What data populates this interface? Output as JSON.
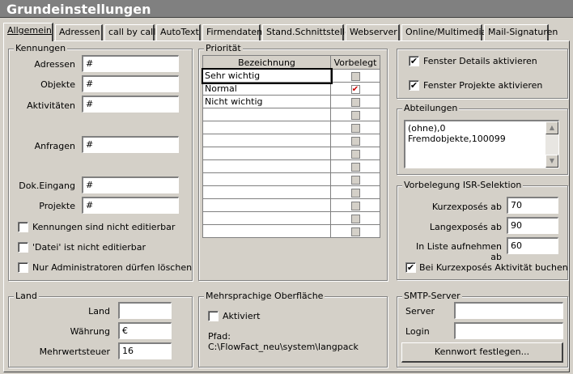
{
  "title": "Grundeinstellungen",
  "tabs": [
    "Allgemein",
    "Adressen",
    "call by call",
    "AutoText",
    "Firmendaten",
    "Stand.Schnittstellen",
    "Webserver",
    "Online/Multimedia",
    "Mail-Signaturen"
  ],
  "kennungen": {
    "legend": "Kennungen",
    "adressen_label": "Adressen",
    "adressen_value": "#",
    "objekte_label": "Objekte",
    "objekte_value": "#",
    "aktivitaeten_label": "Aktivitäten",
    "aktivitaeten_value": "#",
    "anfragen_label": "Anfragen",
    "anfragen_value": "#",
    "dokeingang_label": "Dok.Eingang",
    "dokeingang_value": "#",
    "projekte_label": "Projekte",
    "projekte_value": "#",
    "cb1": "Kennungen sind nicht editierbar",
    "cb2": "'Datei' ist nicht editierbar",
    "cb3": "Nur Administratoren dürfen löschen"
  },
  "prioritaet": {
    "legend": "Priorität",
    "col_bezeichnung": "Bezeichnung",
    "col_vorbelegt": "Vorbelegt",
    "rows": [
      "Sehr wichtig",
      "Normal",
      "Nicht wichtig",
      "",
      "",
      "",
      "",
      "",
      "",
      "",
      "",
      "",
      ""
    ],
    "checked_index": 1
  },
  "fenster": {
    "details": "Fenster Details aktivieren",
    "projekte": "Fenster Projekte aktivieren"
  },
  "abteilungen": {
    "legend": "Abteilungen",
    "item1": "(ohne),0",
    "item2": "Fremdobjekte,100099"
  },
  "isr": {
    "legend": "Vorbelegung ISR-Selektion",
    "kurz_label": "Kurzexposés ab",
    "kurz_value": "70",
    "lang_label": "Langexposés ab",
    "lang_value": "90",
    "liste_label": "In Liste aufnehmen ab",
    "liste_value": "60",
    "cb": "Bei Kurzexposés Aktivität buchen"
  },
  "land": {
    "legend": "Land",
    "land_label": "Land",
    "land_value": "",
    "waehrung_label": "Währung",
    "waehrung_value": "€",
    "mwst_label": "Mehrwertsteuer",
    "mwst_value": "16"
  },
  "mehrsprachig": {
    "legend": "Mehrsprachige Oberfläche",
    "aktiviert": "Aktiviert",
    "pfad_label": "Pfad:",
    "pfad_value": "C:\\FlowFact_neu\\system\\langpack"
  },
  "smtp": {
    "legend": "SMTP-Server",
    "server_label": "Server",
    "server_value": "",
    "login_label": "Login",
    "login_value": "",
    "button": "Kennwort festlegen..."
  }
}
